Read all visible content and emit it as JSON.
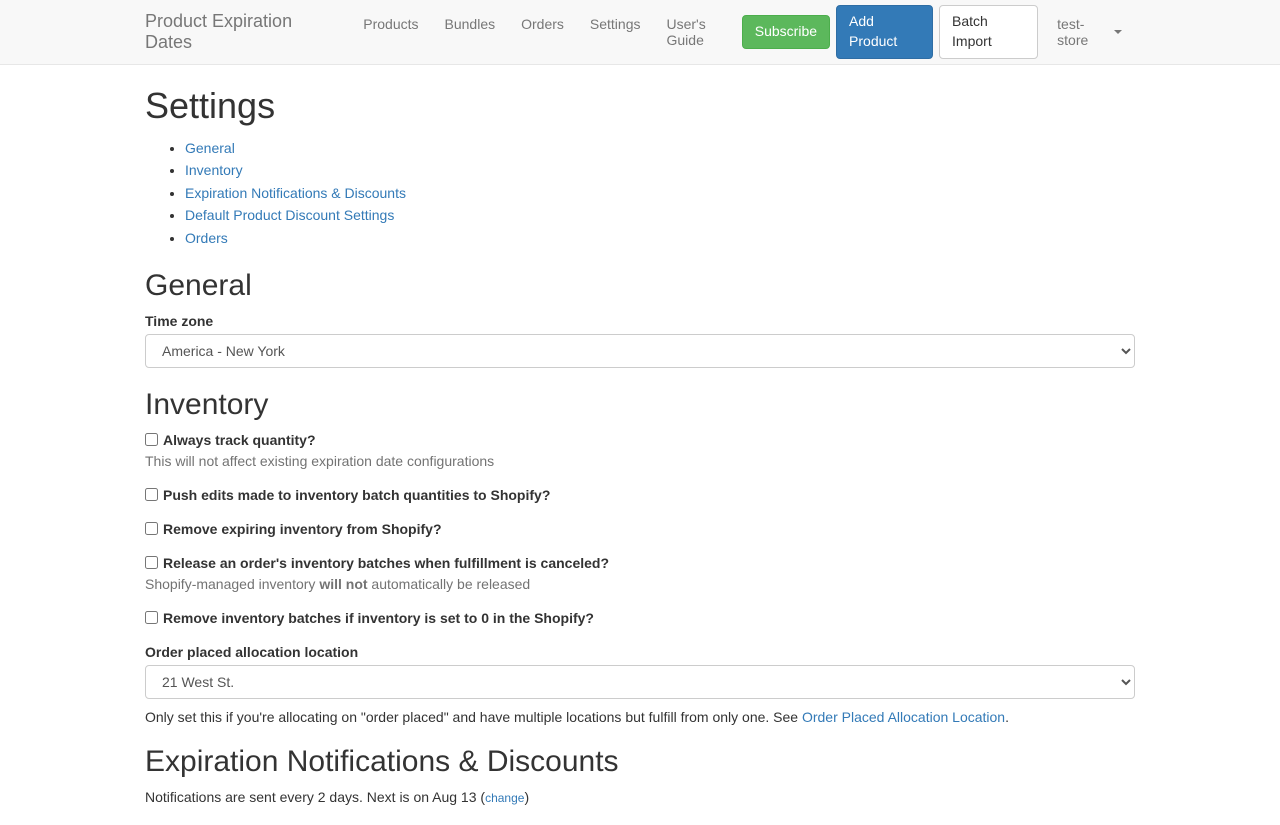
{
  "navbar": {
    "brand": "Product Expiration Dates",
    "links": [
      "Products",
      "Bundles",
      "Orders",
      "Settings",
      "User's Guide"
    ],
    "subscribe": "Subscribe",
    "add_product": "Add Product",
    "batch_import": "Batch Import",
    "store_name": "test-store"
  },
  "page": {
    "title": "Settings",
    "toc": [
      "General",
      "Inventory",
      "Expiration Notifications & Discounts",
      "Default Product Discount Settings",
      "Orders"
    ]
  },
  "general": {
    "heading": "General",
    "timezone_label": "Time zone",
    "timezone_value": "America - New York"
  },
  "inventory": {
    "heading": "Inventory",
    "always_track": "Always track quantity?",
    "always_track_help": "This will not affect existing expiration date configurations",
    "push_edits": "Push edits made to inventory batch quantities to Shopify?",
    "remove_expiring": "Remove expiring inventory from Shopify?",
    "release_canceled": "Release an order's inventory batches when fulfillment is canceled?",
    "release_help_prefix": "Shopify-managed inventory ",
    "release_help_strong": "will not",
    "release_help_suffix": " automatically be released",
    "remove_zero": "Remove inventory batches if inventory is set to 0 in the Shopify?",
    "allocation_label": "Order placed allocation location",
    "allocation_value": "21 West St.",
    "allocation_help_prefix": "Only set this if you're allocating on \"order placed\" and have multiple locations but fulfill from only one. See ",
    "allocation_help_link": "Order Placed Allocation Location",
    "allocation_help_suffix": "."
  },
  "expiration": {
    "heading": "Expiration Notifications & Discounts",
    "notification_text_prefix": "Notifications are sent every 2 days. Next is on Aug 13 (",
    "notification_change": "change",
    "notification_text_suffix": ")"
  }
}
